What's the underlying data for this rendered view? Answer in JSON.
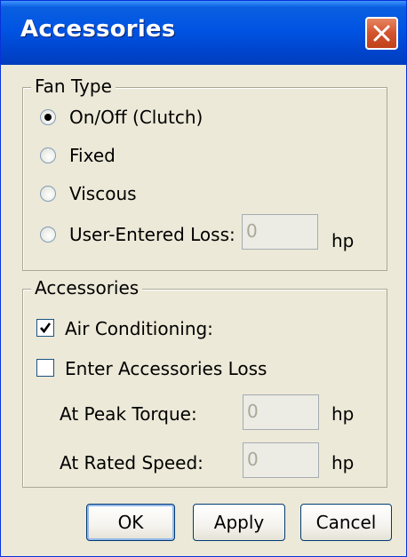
{
  "window": {
    "title": "Accessories",
    "close_icon": "close-icon"
  },
  "fan_type": {
    "label": "Fan Type",
    "options": [
      {
        "label": "On/Off (Clutch)",
        "checked": true
      },
      {
        "label": "Fixed",
        "checked": false
      },
      {
        "label": "Viscous",
        "checked": false
      },
      {
        "label": "User-Entered Loss:",
        "checked": false
      }
    ],
    "loss_value": "0",
    "loss_unit": "hp"
  },
  "accessories": {
    "label": "Accessories",
    "air_conditioning": {
      "label": "Air Conditioning:",
      "checked": true
    },
    "enter_loss": {
      "label": "Enter Accessories Loss",
      "checked": false
    },
    "peak_torque": {
      "label": "At Peak Torque:",
      "value": "0",
      "unit": "hp"
    },
    "rated_speed": {
      "label": "At Rated Speed:",
      "value": "0",
      "unit": "hp"
    }
  },
  "buttons": {
    "ok": "OK",
    "apply": "Apply",
    "cancel": "Cancel"
  },
  "colors": {
    "title_bar": "#0054e3",
    "dialog_bg": "#ece9d8",
    "close_button": "#d2532e"
  }
}
